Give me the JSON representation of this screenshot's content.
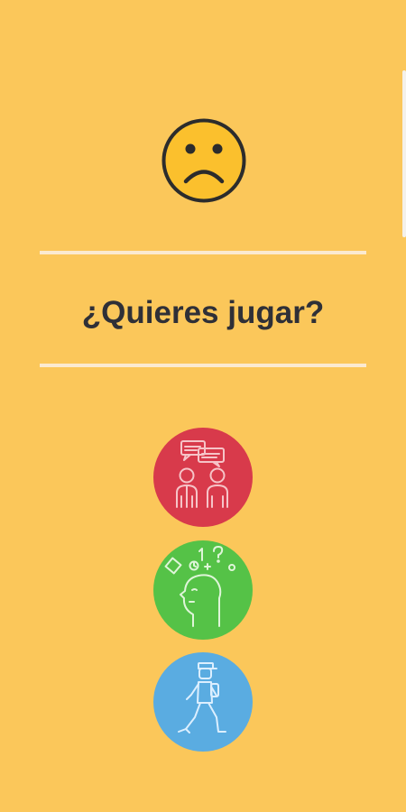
{
  "screen": {
    "question": "¿Quieres jugar?",
    "mood_icon": "sad-face-icon",
    "background_color": "#fbc75a",
    "text_color": "#2f3037"
  },
  "options": [
    {
      "icon": "people-talking-icon",
      "color": "#d83a4b"
    },
    {
      "icon": "head-thinking-icon",
      "color": "#55c247"
    },
    {
      "icon": "person-walking-icon",
      "color": "#5aace1"
    }
  ]
}
